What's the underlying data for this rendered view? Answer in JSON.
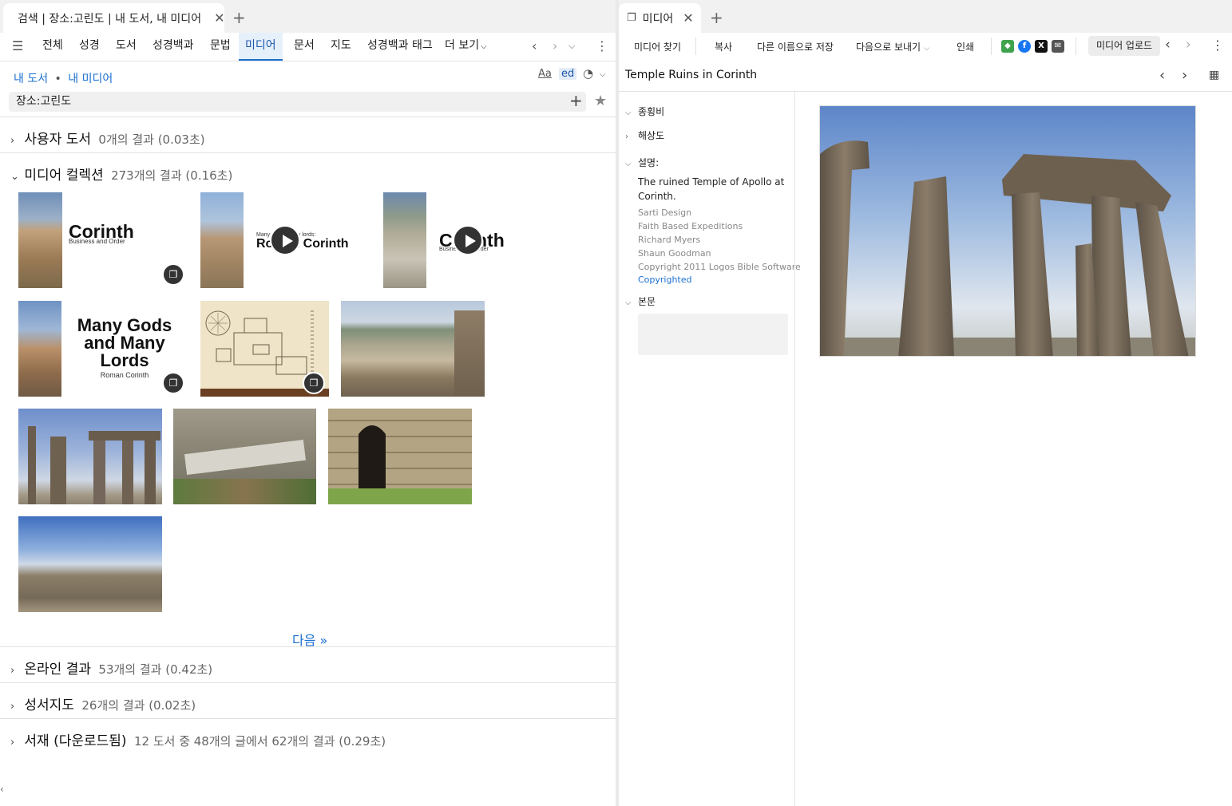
{
  "left": {
    "tab": {
      "title": "검색 | 장소:고린도 | 내 도서, 내 미디어"
    },
    "nav": [
      "전체",
      "성경",
      "도서",
      "성경백과",
      "문법",
      "미디어",
      "문서",
      "지도",
      "성경백과 태그",
      "더 보기"
    ],
    "active_nav": "미디어",
    "breadcrumb": {
      "first": "내 도서",
      "separator": "•",
      "second": "내 미디어"
    },
    "tools": {
      "font": "Aa",
      "ed": "ed"
    },
    "query": "장소:고린도",
    "sections": {
      "user_books": {
        "title": "사용자 도서",
        "meta": "0개의 결과 (0.03초)"
      },
      "media": {
        "title": "미디어 컬렉션",
        "meta": "273개의 결과 (0.16초)"
      },
      "online": {
        "title": "온라인 결과",
        "meta": "53개의 결과 (0.42초)"
      },
      "atlas": {
        "title": "성서지도",
        "meta": "26개의 결과 (0.02초)"
      },
      "catalog": {
        "title": "서재 (다운로드됨)",
        "meta": "12 도서 중 48개의 글에서 62개의 결과 (0.29초)"
      }
    },
    "thumbs": {
      "t1": {
        "title": "Corinth",
        "subtitle": "Business and Order"
      },
      "t2": {
        "kicker": "Many gods, many lords:",
        "title": "Roman Corinth"
      },
      "t3": {
        "title": "Corinth",
        "subtitle": "Business and Order"
      },
      "t4": {
        "line1": "Many Gods",
        "line2": "and Many",
        "line3": "Lords",
        "subtitle": "Roman Corinth"
      }
    },
    "next": "다음 »"
  },
  "right": {
    "tab": {
      "title": "미디어"
    },
    "toolbar": {
      "find": "미디어 찾기",
      "copy": "복사",
      "save_as": "다른 이름으로 저장",
      "send_to": "다음으로 보내기",
      "print": "인쇄",
      "upload": "미디어 업로드"
    },
    "share": {
      "x": "X"
    },
    "media_title": "Temple Ruins in Corinth",
    "props": {
      "aspect": "종횡비",
      "resolution": "해상도",
      "description_label": "설명:",
      "body_label": "본문"
    },
    "description": "The ruined Temple of Apollo at Corinth.",
    "credits": [
      "Sarti Design",
      "Faith Based Expeditions",
      "Richard Myers",
      "Shaun Goodman",
      "Copyright 2011 Logos Bible Software"
    ],
    "rights": "Copyrighted"
  }
}
